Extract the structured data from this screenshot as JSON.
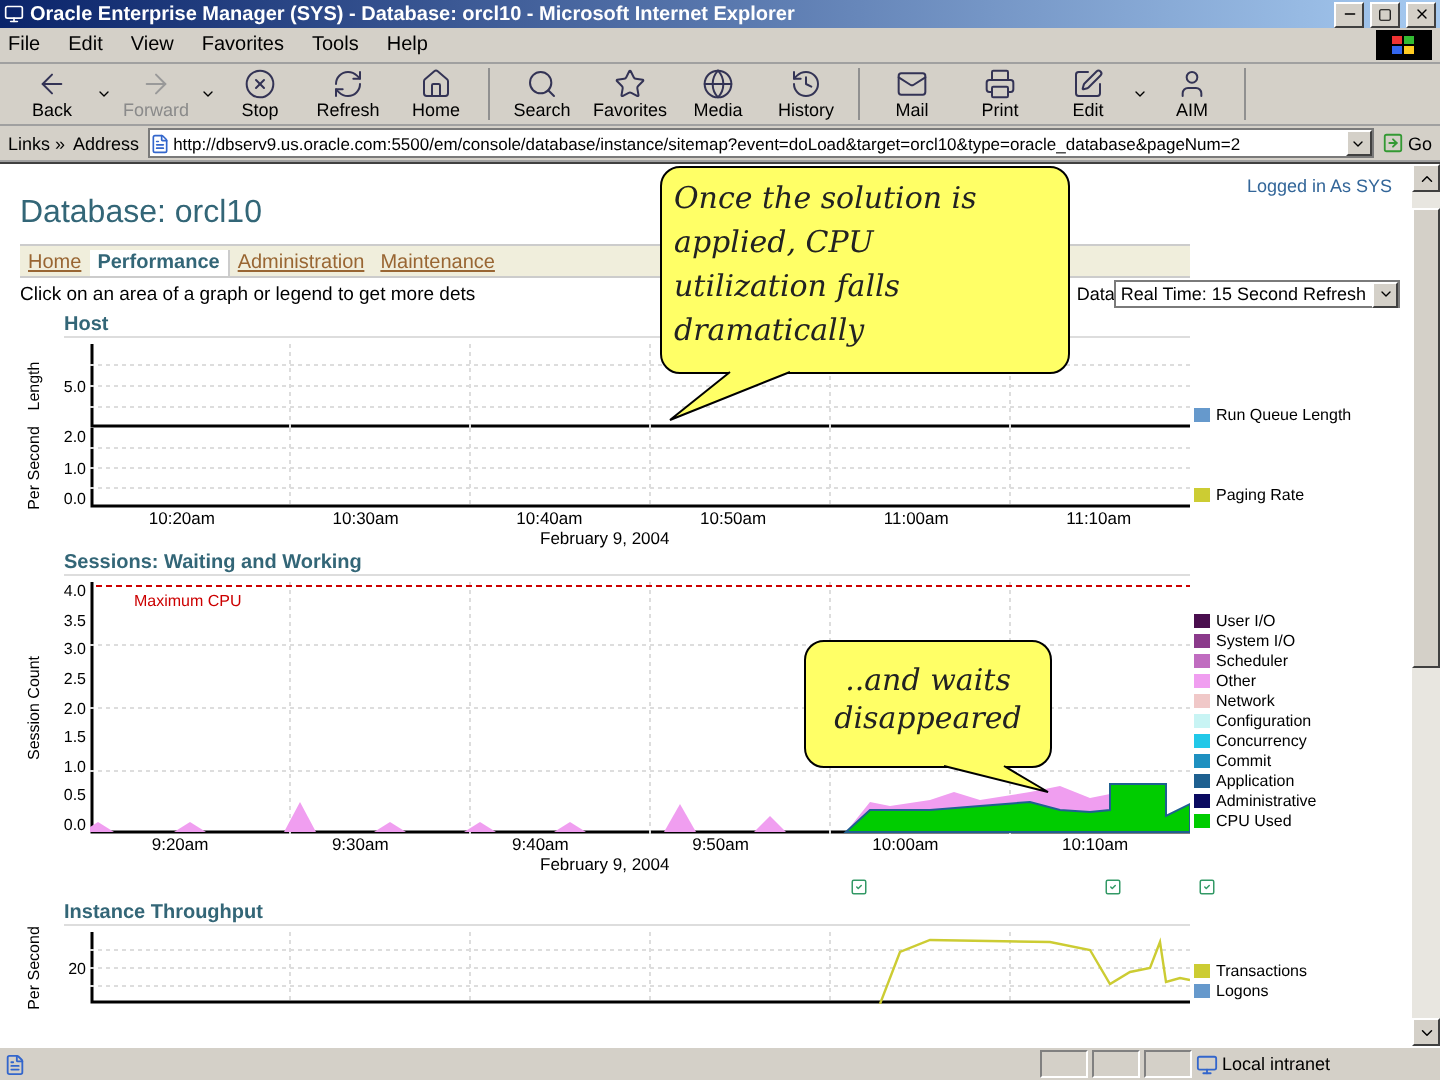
{
  "window": {
    "title": "Oracle Enterprise Manager (SYS) - Database: orcl10 - Microsoft Internet Explorer"
  },
  "menu": [
    "File",
    "Edit",
    "View",
    "Favorites",
    "Tools",
    "Help"
  ],
  "toolbar": [
    {
      "buttons": [
        {
          "kind": "back",
          "label": "Back",
          "dropdown": true,
          "disabled": false
        },
        {
          "kind": "forward",
          "label": "Forward",
          "dropdown": true,
          "disabled": true
        },
        {
          "kind": "stop",
          "label": "Stop",
          "dropdown": false,
          "disabled": false
        },
        {
          "kind": "refresh",
          "label": "Refresh",
          "dropdown": false,
          "disabled": false
        },
        {
          "kind": "home",
          "label": "Home",
          "dropdown": false,
          "disabled": false
        }
      ]
    },
    {
      "buttons": [
        {
          "kind": "search",
          "label": "Search",
          "dropdown": false,
          "disabled": false
        },
        {
          "kind": "favorites",
          "label": "Favorites",
          "dropdown": false,
          "disabled": false
        },
        {
          "kind": "media",
          "label": "Media",
          "dropdown": false,
          "disabled": false
        },
        {
          "kind": "history",
          "label": "History",
          "dropdown": false,
          "disabled": false
        }
      ]
    },
    {
      "buttons": [
        {
          "kind": "mail",
          "label": "Mail",
          "dropdown": false,
          "disabled": false
        },
        {
          "kind": "print",
          "label": "Print",
          "dropdown": false,
          "disabled": false
        },
        {
          "kind": "edit",
          "label": "Edit",
          "dropdown": true,
          "disabled": false
        },
        {
          "kind": "aim",
          "label": "AIM",
          "dropdown": false,
          "disabled": false
        }
      ]
    }
  ],
  "links_label": "Links »",
  "address_label": "Address",
  "address": "http://dbserv9.us.oracle.com:5500/em/console/database/instance/sitemap?event=doLoad&target=orcl10&type=oracle_database&pageNum=2",
  "go": "Go",
  "page": {
    "user": "Logged in As SYS",
    "title": "Database: orcl10",
    "tabs": [
      {
        "label": "Home",
        "selected": false
      },
      {
        "label": "Performance",
        "selected": true
      },
      {
        "label": "Administration",
        "selected": false
      },
      {
        "label": "Maintenance",
        "selected": false
      }
    ],
    "hint": "Click on an area of a graph or legend to get more dets",
    "view_label": "Data",
    "refresh": "Real Time: 15 Second Refresh"
  },
  "sections": [
    {
      "title": "Host",
      "charts": [
        {
          "kind": "empty",
          "axis_label": "Length",
          "ticks": [
            "5.0"
          ],
          "legend": [
            {
              "label": "Run Queue Length",
              "color": "#6699cc"
            }
          ]
        },
        {
          "kind": "empty",
          "axis_label": "Per Second",
          "ticks": [
            "2.0",
            "1.0",
            "0.0"
          ],
          "legend": [
            {
              "label": "Paging Rate",
              "color": "#cccc33"
            }
          ]
        }
      ],
      "times": [
        "10:20am",
        "10:30am",
        "10:40am",
        "10:50am",
        "11:00am",
        "11:10am"
      ],
      "date": "February 9, 2004"
    },
    {
      "title": "Sessions: Waiting and Working",
      "charts": [
        {
          "kind": "sessions",
          "axis_label": "Session Count",
          "max_label": "Maximum CPU",
          "ticks": [
            "4.0",
            "3.5",
            "3.0",
            "2.5",
            "2.0",
            "1.5",
            "1.0",
            "0.5",
            "0.0"
          ],
          "legend": [
            {
              "label": "User I/O",
              "color": "#4a0e4e"
            },
            {
              "label": "System I/O",
              "color": "#8b3a8b"
            },
            {
              "label": "Scheduler",
              "color": "#c06cc0"
            },
            {
              "label": "Other",
              "color": "#f09ef0"
            },
            {
              "label": "Network",
              "color": "#f0c8c8"
            },
            {
              "label": "Configuration",
              "color": "#c8f4f4"
            },
            {
              "label": "Concurrency",
              "color": "#22c8e8"
            },
            {
              "label": "Commit",
              "color": "#1e90c0"
            },
            {
              "label": "Application",
              "color": "#1e6090"
            },
            {
              "label": "Administrative",
              "color": "#0a0a60"
            },
            {
              "label": "CPU Used",
              "color": "#00cc00"
            }
          ]
        }
      ],
      "times": [
        "9:20am",
        "9:30am",
        "9:40am",
        "9:50am",
        "10:00am",
        "10:10am"
      ],
      "date": "February 9, 2004"
    },
    {
      "title": "Instance Throughput",
      "charts": [
        {
          "kind": "throughput",
          "axis_label": "Per Second",
          "ticks": [
            "20"
          ],
          "legend": [
            {
              "label": "Transactions",
              "color": "#cccc33"
            },
            {
              "label": "Logons",
              "color": "#6699cc"
            }
          ]
        }
      ]
    }
  ],
  "callouts": [
    {
      "text": "Once the solution is applied, CPU utilization falls dramatically"
    },
    {
      "text": "..and waits disappeared"
    }
  ],
  "status_bar": {
    "zone": "Local intranet"
  }
}
